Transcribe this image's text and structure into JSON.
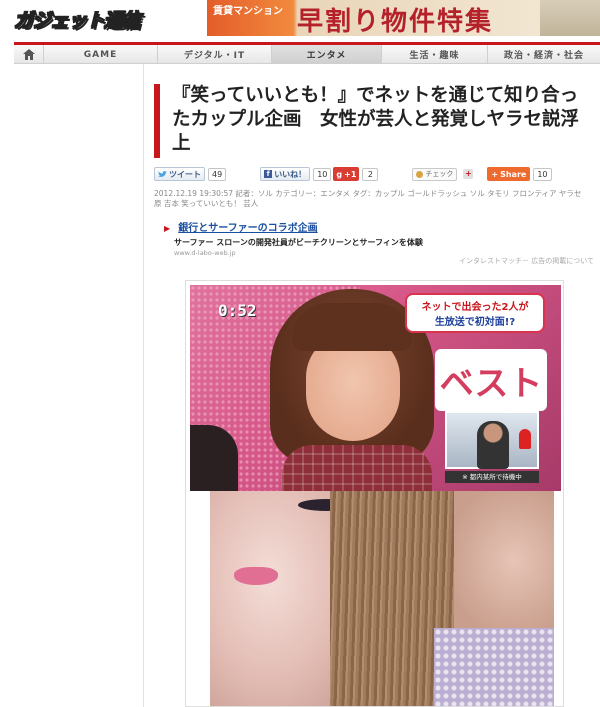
{
  "header": {
    "logo_text": "ガジェット通信",
    "banner_small": "賃貸マンション",
    "banner_big": "早割り物件特集"
  },
  "nav": {
    "home_icon": "home-icon",
    "items": [
      "GAME",
      "デジタル・IT",
      "エンタメ",
      "生活・趣味",
      "政治・経済・社会"
    ],
    "active_index": 2
  },
  "article": {
    "title": "『笑っていいとも！』でネットを通じて知り合ったカップル企画　女性が芸人と発覚しヤラセ説浮上",
    "social": {
      "tweet_label": "ツイート",
      "tweet_count": "49",
      "like_label": "いいね！",
      "like_count": "10",
      "gplus_label": "+1",
      "gplus_count": "2",
      "check_label": "チェック",
      "share_label": "Share",
      "share_count": "10"
    },
    "meta_line1": "2012.12.19 19:30:57 記者：ソル カテゴリー：エンタメ タグ：カップル ゴールドラッシュ ソル タモリ フロンティア ヤラセ",
    "meta_line2": "原 吉本 笑っていいとも！ 芸人"
  },
  "ad": {
    "title": "銀行とサーファーのコラボ企画",
    "desc": "サーファー スローンの開発社員がビーチクリーンとサーフィンを体験",
    "url": "www.d-labo-web.jp",
    "note": "インタレストマッチ－ 広告の掲載について"
  },
  "image": {
    "timecode": "0:52",
    "caption_line1": "ネットで出会った2人が",
    "caption_line2": "生放送で初対面!?",
    "big_text": "ベスト",
    "sub_caption": "※ 都内某所で待機中"
  }
}
